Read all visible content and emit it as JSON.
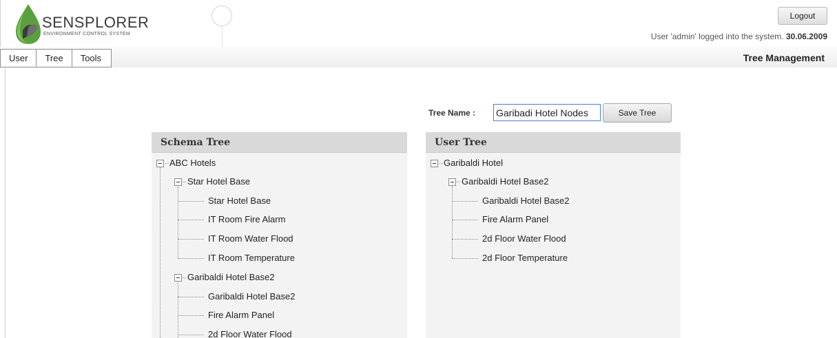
{
  "header": {
    "logo_title": "SENSPLORER",
    "logo_subtitle": "ENVIRONMENT CONTROL SYSTEM",
    "logout_label": "Logout",
    "login_text": "User 'admin' logged into the system.",
    "login_date": "30.06.2009"
  },
  "menu": {
    "items": [
      "User",
      "Tree",
      "Tools"
    ]
  },
  "page_title": "Tree Management",
  "tree_name": {
    "label": "Tree Name :",
    "value": "Garibadi Hotel Nodes",
    "save_label": "Save Tree"
  },
  "schema_tree": {
    "title": "Schema Tree",
    "nodes": [
      "ABC Hotels",
      "Star Hotel Base",
      "Star Hotel Base",
      "IT Room Fire Alarm",
      "IT Room Water Flood",
      "IT Room Temperature",
      "Garibaldi Hotel Base2",
      "Garibaldi Hotel Base2",
      "Fire Alarm Panel",
      "2d Floor Water Flood"
    ]
  },
  "user_tree": {
    "title": "User Tree",
    "nodes": [
      "Garibaldi Hotel",
      "Garibaldi Hotel Base2",
      "Garibaldi Hotel Base2",
      "Fire Alarm Panel",
      "2d Floor Water Flood",
      "2d Floor Temperature"
    ]
  },
  "colors": {
    "panel_bg": "#f3f3f3",
    "panel_header_bg": "#d9d9d9",
    "input_border": "#4a7fcf",
    "logo_green": "#5aa03c"
  }
}
